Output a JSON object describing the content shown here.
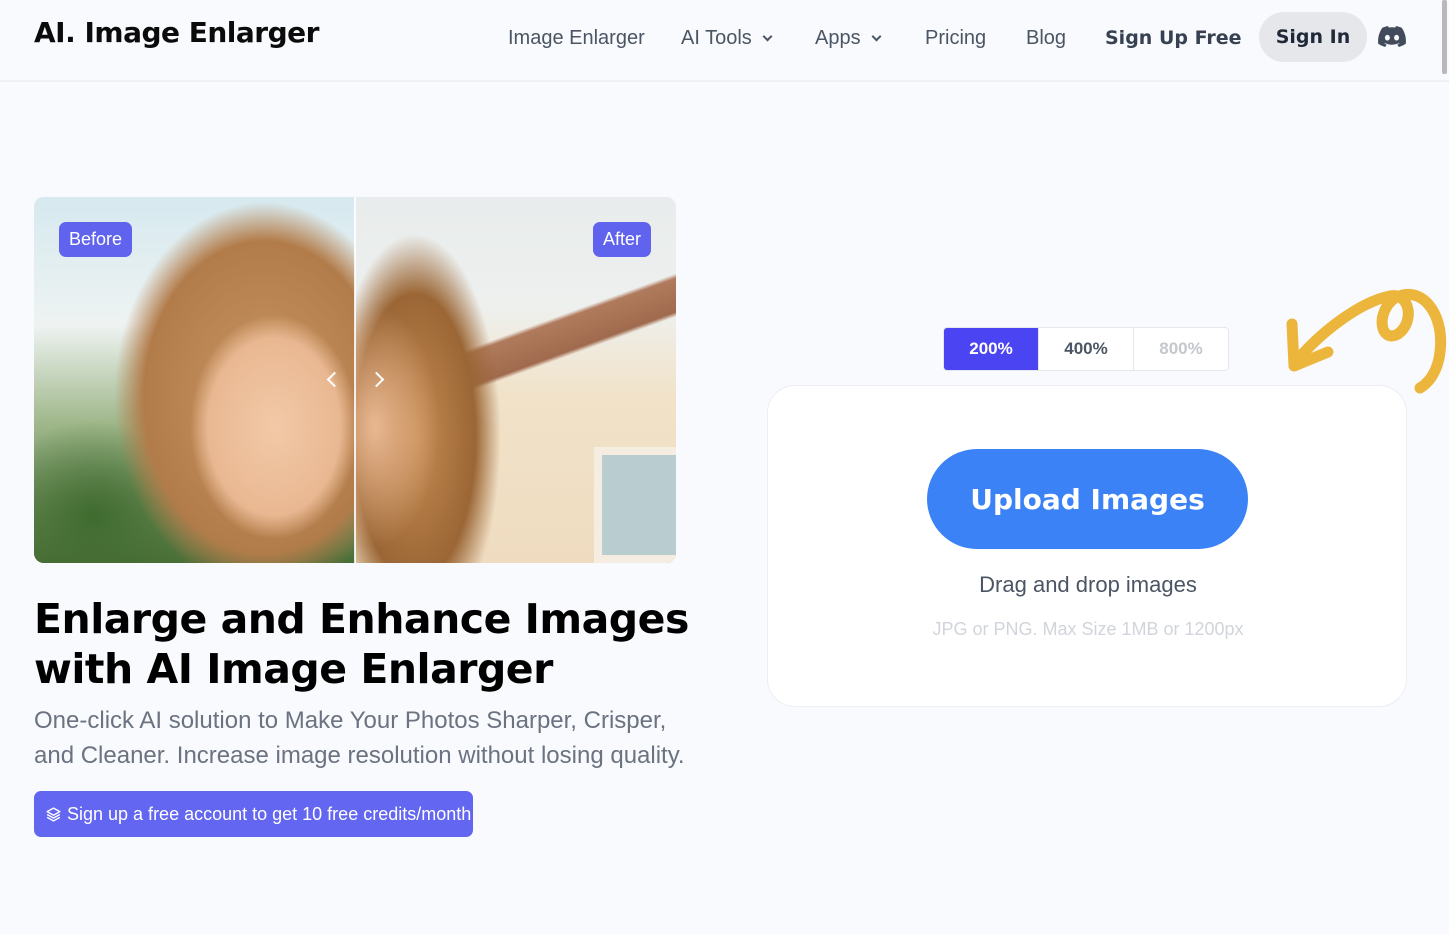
{
  "header": {
    "logo": "AI. Image Enlarger",
    "nav": [
      {
        "label": "Image Enlarger",
        "has_dropdown": false
      },
      {
        "label": "AI Tools",
        "has_dropdown": true
      },
      {
        "label": "Apps",
        "has_dropdown": true
      },
      {
        "label": "Pricing",
        "has_dropdown": false
      },
      {
        "label": "Blog",
        "has_dropdown": false
      }
    ],
    "signup_label": "Sign Up Free",
    "signin_label": "Sign In",
    "discord_icon": "discord-icon"
  },
  "hero": {
    "compare": {
      "before_label": "Before",
      "after_label": "After",
      "handle_icons": [
        "chevron-left-icon",
        "chevron-right-icon"
      ]
    },
    "headline": "Enlarge and Enhance Images with AI Image Enlarger",
    "subtext": "One-click AI solution to Make Your Photos Sharper, Crisper, and Cleaner. Increase image resolution without losing quality.",
    "promo_button": {
      "icon": "layers-icon",
      "label": "Sign up a free account to get 10 free credits/month"
    }
  },
  "uploader": {
    "scale_options": [
      {
        "label": "200%",
        "state": "selected"
      },
      {
        "label": "400%",
        "state": "enabled"
      },
      {
        "label": "800%",
        "state": "disabled"
      }
    ],
    "upload_button": "Upload Images",
    "drag_text": "Drag and drop images",
    "limit_text": "JPG or PNG. Max Size 1MB or 1200px"
  },
  "colors": {
    "accent": "#6366f1",
    "scale_selected": "#4a44f2",
    "upload_blue": "#3b82f6",
    "squiggle": "#ecb63d",
    "background": "#f8fafd"
  }
}
